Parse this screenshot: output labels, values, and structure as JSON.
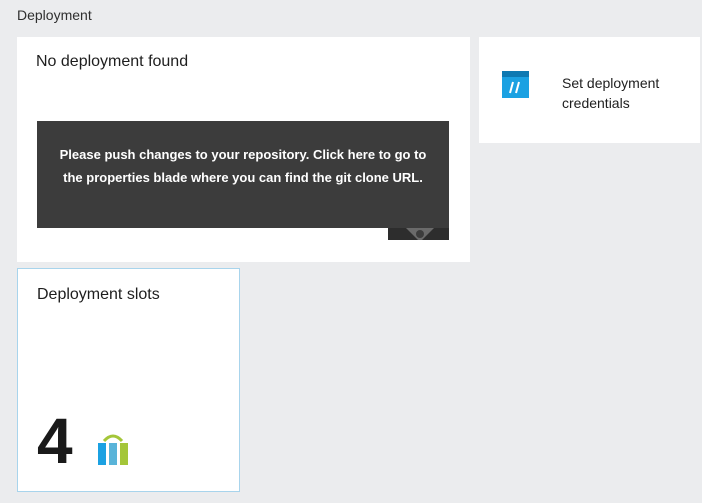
{
  "section": {
    "title": "Deployment"
  },
  "deployment_tile": {
    "heading": "No deployment found",
    "tooltip_text": "Please push changes to your repository. Click here to go to the properties blade where you can find the git clone URL."
  },
  "credentials_tile": {
    "label": "Set deployment credentials",
    "icon": "credentials-icon"
  },
  "slots_tile": {
    "heading": "Deployment slots",
    "count": "4",
    "icon": "deployment-slots-icon"
  },
  "colors": {
    "page_background": "#ebecee",
    "tile_background": "#ffffff",
    "tooltip_background": "#3c3c3c",
    "accent_blue": "#1ba1e2",
    "slots_tile_border": "#a8d4ec"
  }
}
